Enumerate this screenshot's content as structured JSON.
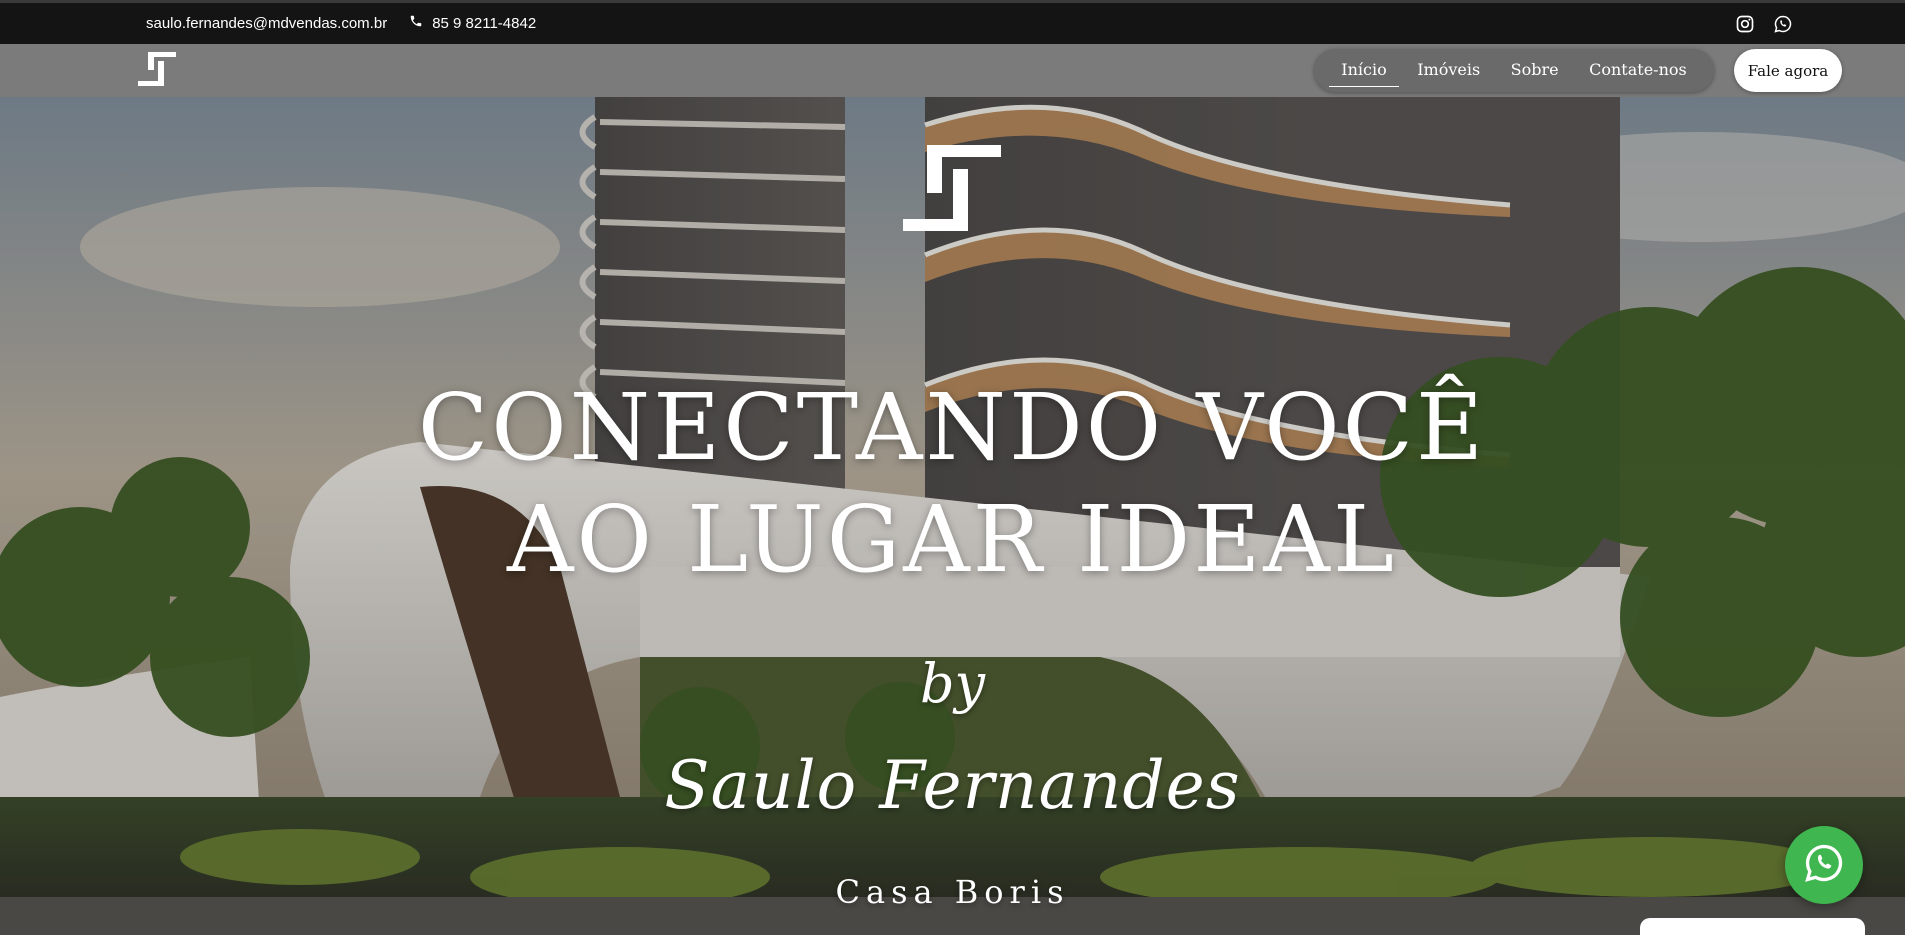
{
  "topbar": {
    "email": "saulo.fernandes@mdvendas.com.br",
    "phone": "85 9 8211-4842",
    "icons": [
      "phone-icon",
      "instagram-icon",
      "whatsapp-icon"
    ]
  },
  "nav": {
    "items": [
      {
        "label": "Início",
        "active": true
      },
      {
        "label": "Imóveis",
        "active": false
      },
      {
        "label": "Sobre",
        "active": false
      },
      {
        "label": "Contate-nos",
        "active": false
      }
    ],
    "cta_label": "Fale agora"
  },
  "hero": {
    "headline_line1": "CONECTANDO VOCÊ",
    "headline_line2": "AO LUGAR IDEAL",
    "by": "by",
    "signature": "Saulo Fernandes",
    "project_name": "Casa Boris"
  },
  "colors": {
    "topbar_bg": "#141414",
    "navbar_bg": "#7b7b7b",
    "whatsapp_green": "#3fb650"
  }
}
